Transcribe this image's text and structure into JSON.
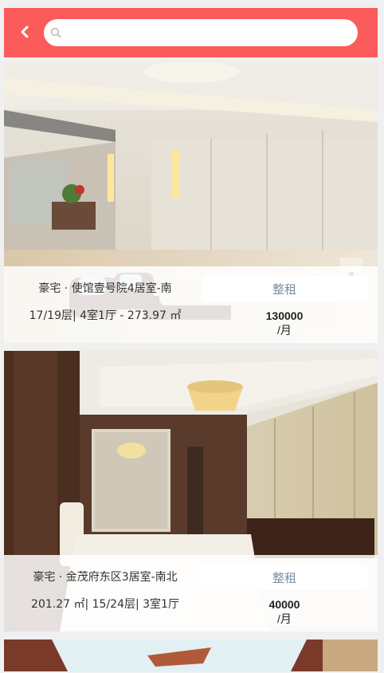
{
  "search": {
    "placeholder": ""
  },
  "listings": [
    {
      "title": "豪宅 · 使馆壹号院4居室-南",
      "meta": "17/19层| 4室1厅 - 273.97 ㎡",
      "tag": "整租",
      "price": "130000",
      "unit": "/月"
    },
    {
      "title": "豪宅 · 金茂府东区3居室-南北",
      "meta": "201.27 ㎡| 15/24层| 3室1厅",
      "tag": "整租",
      "price": "40000",
      "unit": "/月"
    }
  ],
  "colors": {
    "header": "#fb5b5b",
    "tag_text": "#7a8ea0"
  },
  "icons": {
    "back": "chevron-left-icon",
    "search": "search-icon"
  }
}
